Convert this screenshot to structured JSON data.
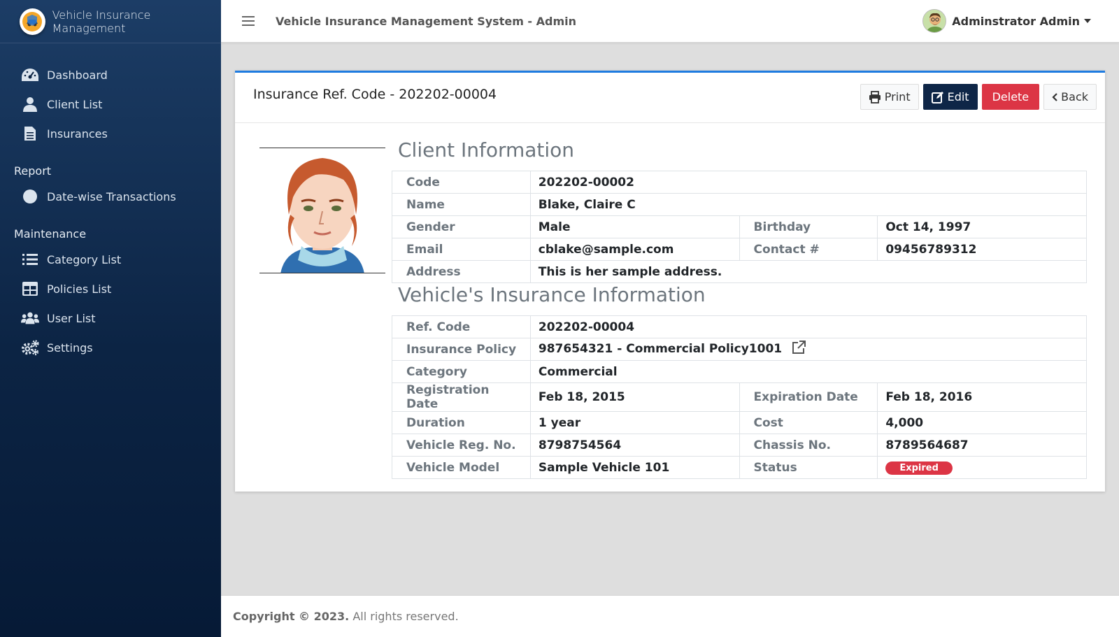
{
  "sidebar": {
    "brand": "Vehicle Insurance Management",
    "items": [
      {
        "label": "Dashboard",
        "icon": "dashboard-icon"
      },
      {
        "label": "Client List",
        "icon": "user-icon"
      },
      {
        "label": "Insurances",
        "icon": "file-icon"
      }
    ],
    "report_header": "Report",
    "report_items": [
      {
        "label": "Date-wise Transactions",
        "icon": "circle-icon"
      }
    ],
    "maintenance_header": "Maintenance",
    "maintenance_items": [
      {
        "label": "Category List",
        "icon": "list-icon"
      },
      {
        "label": "Policies List",
        "icon": "table-icon"
      },
      {
        "label": "User List",
        "icon": "users-icon"
      },
      {
        "label": "Settings",
        "icon": "gears-icon"
      }
    ]
  },
  "topbar": {
    "title": "Vehicle Insurance Management System - Admin",
    "user_name": "Adminstrator Admin"
  },
  "card": {
    "title": "Insurance Ref. Code - 202202-00004",
    "buttons": {
      "print": "Print",
      "edit": "Edit",
      "delete": "Delete",
      "back": "Back"
    }
  },
  "client": {
    "section_title": "Client Information",
    "code_label": "Code",
    "code": "202202-00002",
    "name_label": "Name",
    "name": "Blake, Claire C",
    "gender_label": "Gender",
    "gender": "Male",
    "birthday_label": "Birthday",
    "birthday": "Oct 14, 1997",
    "email_label": "Email",
    "email": "cblake@sample.com",
    "contact_label": "Contact #",
    "contact": "09456789312",
    "address_label": "Address",
    "address": "This is her sample address."
  },
  "insurance": {
    "section_title": "Vehicle's Insurance Information",
    "ref_label": "Ref. Code",
    "ref": "202202-00004",
    "policy_label": "Insurance Policy",
    "policy": "987654321 - Commercial Policy1001",
    "category_label": "Category",
    "category": "Commercial",
    "reg_date_label": "Registration Date",
    "reg_date": "Feb 18, 2015",
    "exp_date_label": "Expiration Date",
    "exp_date": "Feb 18, 2016",
    "duration_label": "Duration",
    "duration": "1 year",
    "cost_label": "Cost",
    "cost": "4,000",
    "veh_reg_label": "Vehicle Reg. No.",
    "veh_reg": "8798754564",
    "chassis_label": "Chassis No.",
    "chassis": "8789564687",
    "model_label": "Vehicle Model",
    "model": "Sample Vehicle 101",
    "status_label": "Status",
    "status": "Expired"
  },
  "footer": {
    "copyright": "Copyright © 2023.",
    "rights": "All rights reserved."
  },
  "colors": {
    "accent": "#1e7be0",
    "sidebar": "#0c2444",
    "danger": "#dc3545",
    "edit": "#0e2647"
  }
}
